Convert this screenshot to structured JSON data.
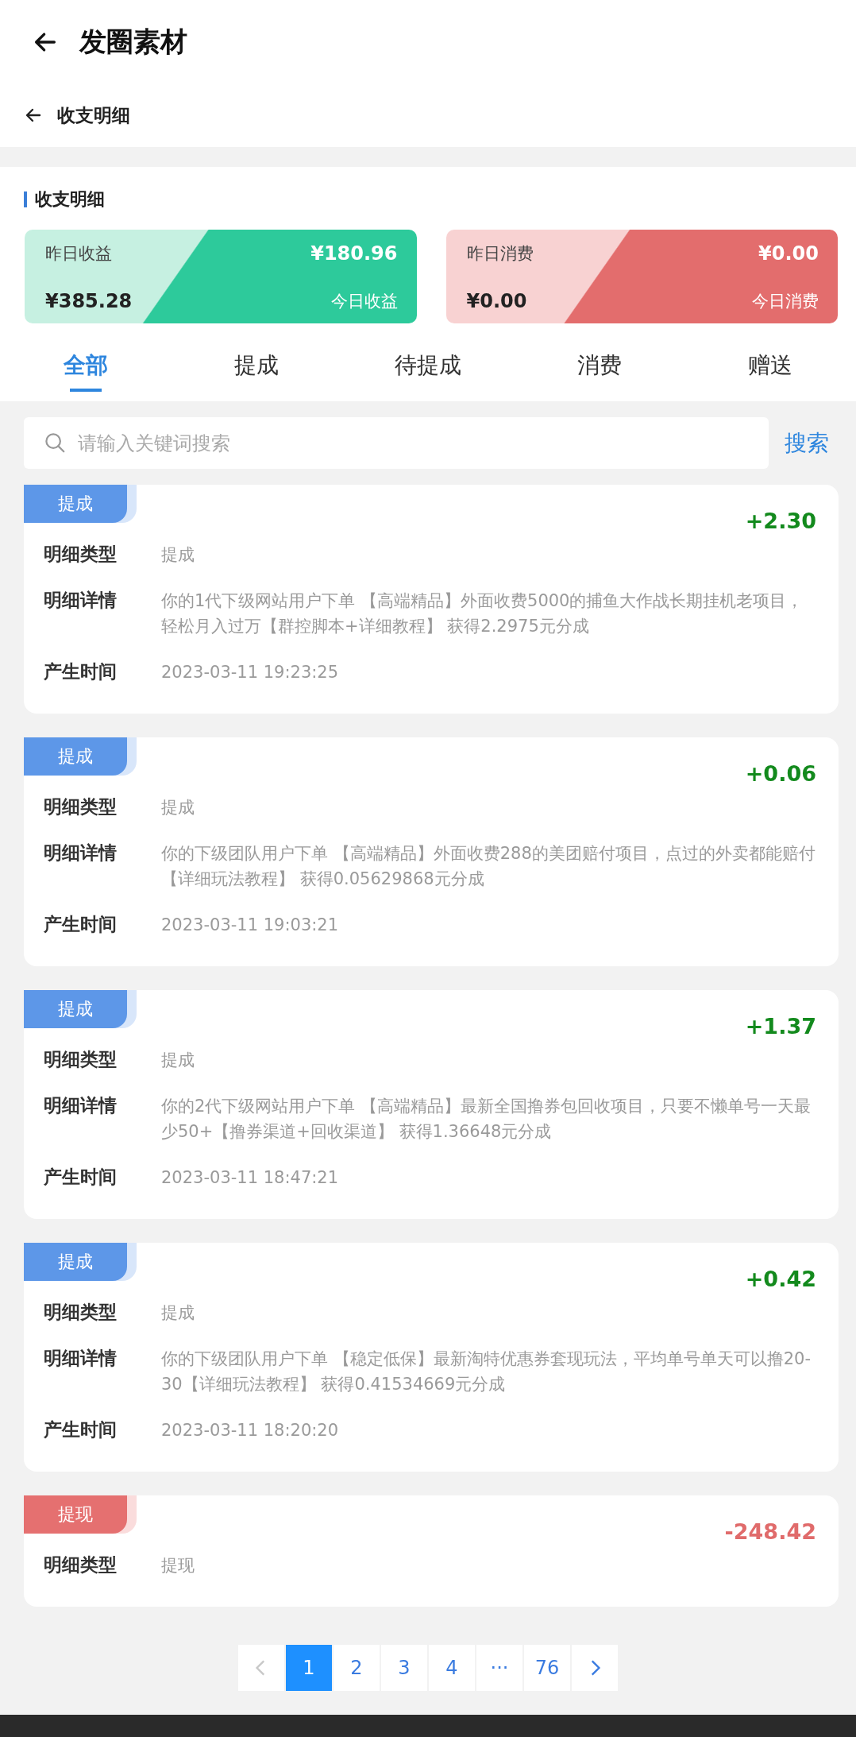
{
  "app_bar": {
    "title": "发圈素材"
  },
  "sub_header": {
    "title": "收支明细"
  },
  "section": {
    "title": "收支明细"
  },
  "summary_cards": [
    {
      "kind": "income",
      "left_label": "昨日收益",
      "left_value": "¥385.28",
      "right_value": "¥180.96",
      "right_label": "今日收益"
    },
    {
      "kind": "expense",
      "left_label": "昨日消费",
      "left_value": "¥0.00",
      "right_value": "¥0.00",
      "right_label": "今日消费"
    }
  ],
  "tabs": [
    {
      "label": "全部",
      "selected": true
    },
    {
      "label": "提成",
      "selected": false
    },
    {
      "label": "待提成",
      "selected": false
    },
    {
      "label": "消费",
      "selected": false
    },
    {
      "label": "赠送",
      "selected": false
    }
  ],
  "search": {
    "placeholder": "请输入关键词搜索",
    "button": "搜索"
  },
  "records": [
    {
      "kind": "income",
      "badge": "提成",
      "amount": "+2.30",
      "rows": [
        {
          "label": "明细类型",
          "value": "提成"
        },
        {
          "label": "明细详情",
          "value": "你的1代下级网站用户下单 【高端精品】外面收费5000的捕鱼大作战长期挂机老项目，轻松月入过万【群控脚本+详细教程】 获得2.2975元分成"
        },
        {
          "label": "产生时间",
          "value": "2023-03-11 19:23:25"
        }
      ]
    },
    {
      "kind": "income",
      "badge": "提成",
      "amount": "+0.06",
      "rows": [
        {
          "label": "明细类型",
          "value": "提成"
        },
        {
          "label": "明细详情",
          "value": "你的下级团队用户下单 【高端精品】外面收费288的美团赔付项目，点过的外卖都能赔付【详细玩法教程】 获得0.05629868元分成"
        },
        {
          "label": "产生时间",
          "value": "2023-03-11 19:03:21"
        }
      ]
    },
    {
      "kind": "income",
      "badge": "提成",
      "amount": "+1.37",
      "rows": [
        {
          "label": "明细类型",
          "value": "提成"
        },
        {
          "label": "明细详情",
          "value": "你的2代下级网站用户下单 【高端精品】最新全国撸券包回收项目，只要不懒单号一天最少50+【撸券渠道+回收渠道】 获得1.36648元分成"
        },
        {
          "label": "产生时间",
          "value": "2023-03-11 18:47:21"
        }
      ]
    },
    {
      "kind": "income",
      "badge": "提成",
      "amount": "+0.42",
      "rows": [
        {
          "label": "明细类型",
          "value": "提成"
        },
        {
          "label": "明细详情",
          "value": "你的下级团队用户下单 【稳定低保】最新淘特优惠券套现玩法，平均单号单天可以撸20-30【详细玩法教程】 获得0.41534669元分成"
        },
        {
          "label": "产生时间",
          "value": "2023-03-11 18:20:20"
        }
      ]
    },
    {
      "kind": "withdraw",
      "badge": "提现",
      "amount": "-248.42",
      "rows": [
        {
          "label": "明细类型",
          "value": "提现"
        }
      ]
    }
  ],
  "pagination": {
    "pages": [
      {
        "label": "1",
        "selected": true
      },
      {
        "label": "2",
        "selected": false
      },
      {
        "label": "3",
        "selected": false
      },
      {
        "label": "4",
        "selected": false
      },
      {
        "label": "···",
        "selected": false
      },
      {
        "label": "76",
        "selected": false
      }
    ]
  }
}
